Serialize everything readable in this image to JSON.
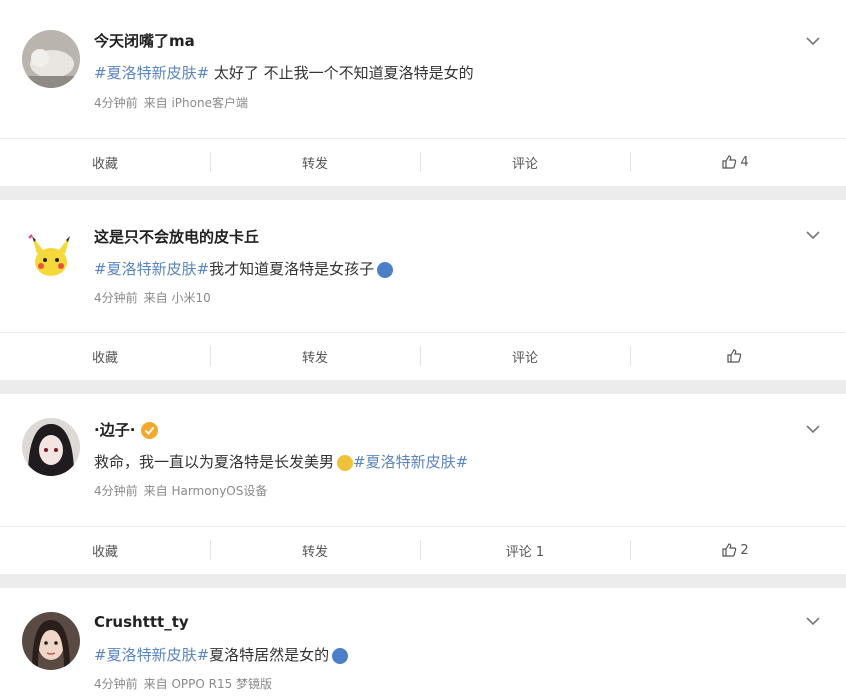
{
  "posts": [
    {
      "username": "今天闭嘴了ma",
      "hashtag": "#夏洛特新皮肤#",
      "text_after": " 太好了 不止我一个不知道夏洛特是女的",
      "time": "4分钟前",
      "source": "来自 iPhone客户端",
      "actions": {
        "collect": "收藏",
        "repost": "转发",
        "comment": "评论",
        "like_count": "4"
      }
    },
    {
      "username": "这是只不会放电的皮卡丘",
      "hashtag": "#夏洛特新皮肤#",
      "text_after": "我才知道夏洛特是女孩子",
      "time": "4分钟前",
      "source": "来自 小米10",
      "actions": {
        "collect": "收藏",
        "repost": "转发",
        "comment": "评论",
        "like_count": ""
      }
    },
    {
      "username": "·边子·",
      "text_before": "救命，我一直以为夏洛特是长发美男",
      "hashtag": "#夏洛特新皮肤#",
      "time": "4分钟前",
      "source": "来自 HarmonyOS设备",
      "actions": {
        "collect": "收藏",
        "repost": "转发",
        "comment": "评论 1",
        "like_count": "2"
      }
    },
    {
      "username": "Crushttt_ty",
      "hashtag": "#夏洛特新皮肤#",
      "text_after": "夏洛特居然是女的",
      "time": "4分钟前",
      "source": "来自 OPPO R15 梦镜版"
    }
  ],
  "colors": {
    "hashtag": "#5b86c0",
    "meta": "#8a8a8a",
    "verified_badge": "#f3a92b"
  },
  "icons": [
    "chevron-down-icon",
    "thumbs-up-icon",
    "verified-badge-icon",
    "emoji-icon"
  ]
}
